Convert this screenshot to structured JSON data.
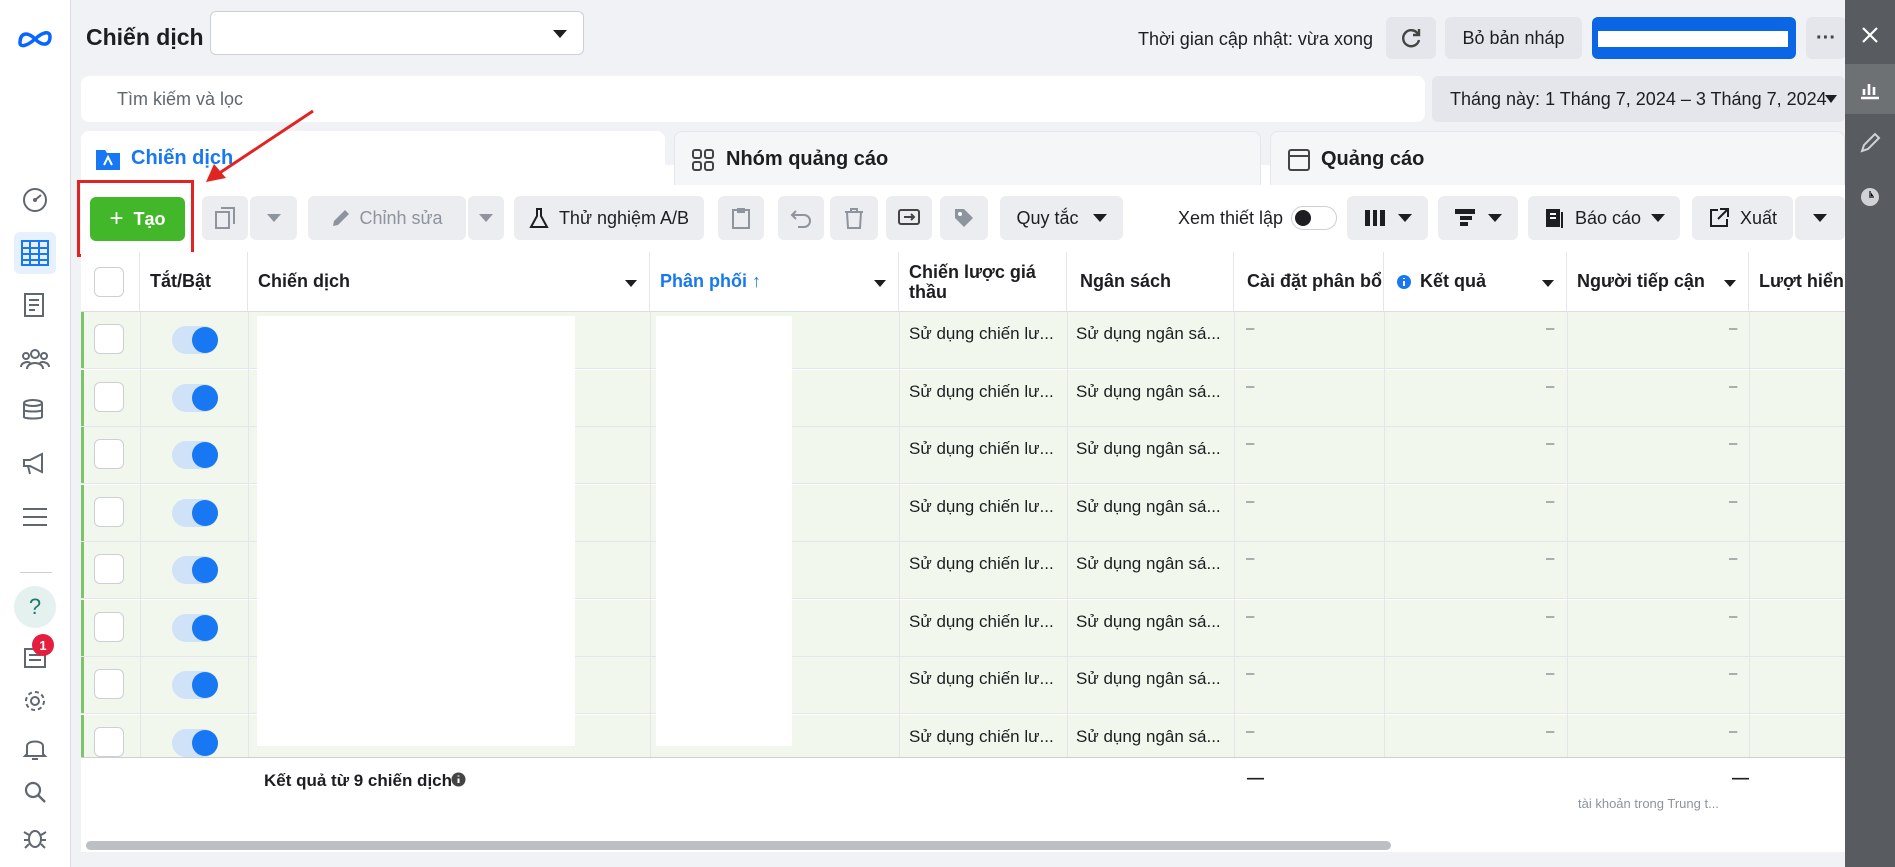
{
  "header": {
    "title": "Chiến dịch",
    "campaign_select_value": "",
    "updated_text": "Thời gian cập nhật: vừa xong",
    "discard_label": "Bỏ bản nháp",
    "more_label": "···"
  },
  "search": {
    "placeholder": "Tìm kiếm và lọc"
  },
  "date_range": "Tháng này: 1 Tháng 7, 2024 – 3 Tháng 7, 2024",
  "tabs": [
    {
      "label": "Chiến dịch",
      "active": true
    },
    {
      "label": "Nhóm quảng cáo",
      "active": false
    },
    {
      "label": "Quảng cáo",
      "active": false
    }
  ],
  "toolbar": {
    "create_label": "Tạo",
    "edit_label": "Chỉnh sửa",
    "ab_test_label": "Thử nghiệm A/B",
    "rules_label": "Quy tắc",
    "view_setup_label": "Xem thiết lập",
    "reports_label": "Báo cáo",
    "export_label": "Xuất"
  },
  "table": {
    "columns": {
      "toggle": "Tắt/Bật",
      "campaign": "Chiến dịch",
      "delivery": "Phân phối ↑",
      "bid_strategy": "Chiến lược giá thầu",
      "budget": "Ngân sách",
      "attribution": "Cài đặt phân bổ",
      "results": "Kết quả",
      "reach": "Người tiếp cận",
      "impressions": "Lượt hiển"
    },
    "rows": [
      {
        "bid": "Sử dụng chiến lư...",
        "budget": "Sử dụng ngân sá...",
        "attribution": "–",
        "results": "–",
        "reach": "–"
      },
      {
        "bid": "Sử dụng chiến lư...",
        "budget": "Sử dụng ngân sá...",
        "attribution": "–",
        "results": "–",
        "reach": "–"
      },
      {
        "bid": "Sử dụng chiến lư...",
        "budget": "Sử dụng ngân sá...",
        "attribution": "–",
        "results": "–",
        "reach": "–"
      },
      {
        "bid": "Sử dụng chiến lư...",
        "budget": "Sử dụng ngân sá...",
        "attribution": "–",
        "results": "–",
        "reach": "–"
      },
      {
        "bid": "Sử dụng chiến lư...",
        "budget": "Sử dụng ngân sá...",
        "attribution": "–",
        "results": "–",
        "reach": "–"
      },
      {
        "bid": "Sử dụng chiến lư...",
        "budget": "Sử dụng ngân sá...",
        "attribution": "–",
        "results": "–",
        "reach": "–"
      },
      {
        "bid": "Sử dụng chiến lư...",
        "budget": "Sử dụng ngân sá...",
        "attribution": "–",
        "results": "–",
        "reach": "–"
      },
      {
        "bid": "Sử dụng chiến lư...",
        "budget": "Sử dụng ngân sá...",
        "attribution": "–",
        "results": "–",
        "reach": "–"
      }
    ],
    "footer": {
      "summary": "Kết quả từ 9 chiến dịch",
      "attribution": "—",
      "reach": "—",
      "reach_note": "tài khoản trong Trung t..."
    }
  },
  "nav": {
    "notification_count": "1"
  },
  "colors": {
    "brand_blue": "#1877f2",
    "create_green": "#42b72a",
    "annotation_red": "#e02424",
    "row_bg": "#f1f7ec"
  }
}
